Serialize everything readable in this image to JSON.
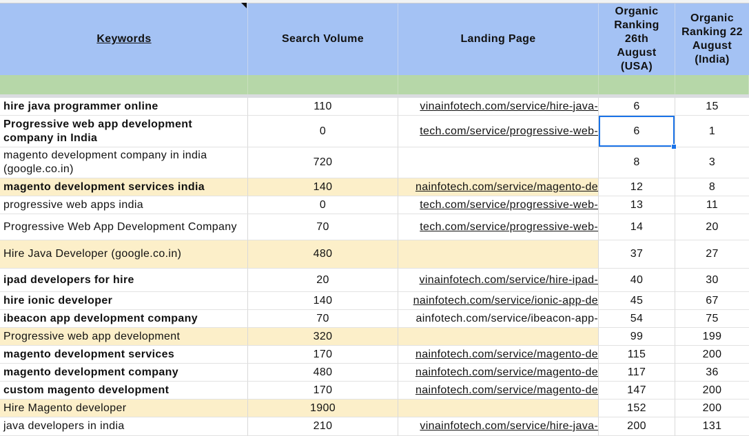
{
  "header": {
    "keywords": "Keywords",
    "search_volume": "Search Volume",
    "landing_page": "Landing Page",
    "rank_usa": "Organic Ranking 26th August (USA)",
    "rank_india": "Organic Ranking 22 August (India)"
  },
  "rows": [
    {
      "keyword": "hire java programmer online",
      "volume": "110",
      "landing": "vinainfotech.com/service/hire-java-",
      "usa": "6",
      "india": "15",
      "bold": true,
      "highlight": false
    },
    {
      "keyword": "Progressive web app development company in India",
      "volume": "0",
      "landing": "tech.com/service/progressive-web-",
      "usa": "6",
      "india": "1",
      "bold": true,
      "highlight": false,
      "selected": true
    },
    {
      "keyword": "magento development company in india (google.co.in)",
      "volume": "720",
      "landing": "",
      "usa": "8",
      "india": "3",
      "bold": false,
      "highlight": false
    },
    {
      "keyword": "magento development services india",
      "volume": "140",
      "landing": "nainfotech.com/service/magento-de",
      "usa": "12",
      "india": "8",
      "bold": true,
      "highlight": true
    },
    {
      "keyword": "progressive web apps india",
      "volume": "0",
      "landing": "tech.com/service/progressive-web-",
      "usa": "13",
      "india": "11",
      "bold": false,
      "highlight": false
    },
    {
      "keyword": "Progressive Web App Development Company",
      "volume": "70",
      "landing": "tech.com/service/progressive-web-",
      "usa": "14",
      "india": "20",
      "bold": false,
      "highlight": false
    },
    {
      "keyword": "Hire Java Developer (google.co.in)",
      "volume": "480",
      "landing": "",
      "usa": "37",
      "india": "27",
      "bold": false,
      "highlight": true
    },
    {
      "keyword": "ipad developers for hire",
      "volume": "20",
      "landing": "vinainfotech.com/service/hire-ipad-",
      "usa": "40",
      "india": "30",
      "bold": true,
      "highlight": false
    },
    {
      "keyword": "hire ionic developer",
      "volume": "140",
      "landing": "nainfotech.com/service/ionic-app-de",
      "usa": "45",
      "india": "67",
      "bold": true,
      "highlight": false
    },
    {
      "keyword": "ibeacon app development company",
      "volume": "70",
      "landing": "ainfotech.com/service/ibeacon-app-",
      "usa": "54",
      "india": "75",
      "bold": true,
      "highlight": false,
      "plain_link": true
    },
    {
      "keyword": "Progressive web app development",
      "volume": "320",
      "landing": "",
      "usa": "99",
      "india": "199",
      "bold": false,
      "highlight": true
    },
    {
      "keyword": "magento development services",
      "volume": "170",
      "landing": "nainfotech.com/service/magento-de",
      "usa": "115",
      "india": "200",
      "bold": true,
      "highlight": false
    },
    {
      "keyword": "magento development company",
      "volume": "480",
      "landing": "nainfotech.com/service/magento-de",
      "usa": "117",
      "india": "36",
      "bold": true,
      "highlight": false
    },
    {
      "keyword": "custom magento development",
      "volume": "170",
      "landing": "nainfotech.com/service/magento-de",
      "usa": "147",
      "india": "200",
      "bold": true,
      "highlight": false
    },
    {
      "keyword": "Hire Magento developer",
      "volume": "1900",
      "landing": "",
      "usa": "152",
      "india": "200",
      "bold": false,
      "highlight": true
    },
    {
      "keyword": "java developers in india",
      "volume": "210",
      "landing": "vinainfotech.com/service/hire-java-",
      "usa": "200",
      "india": "131",
      "bold": false,
      "highlight": false
    }
  ]
}
